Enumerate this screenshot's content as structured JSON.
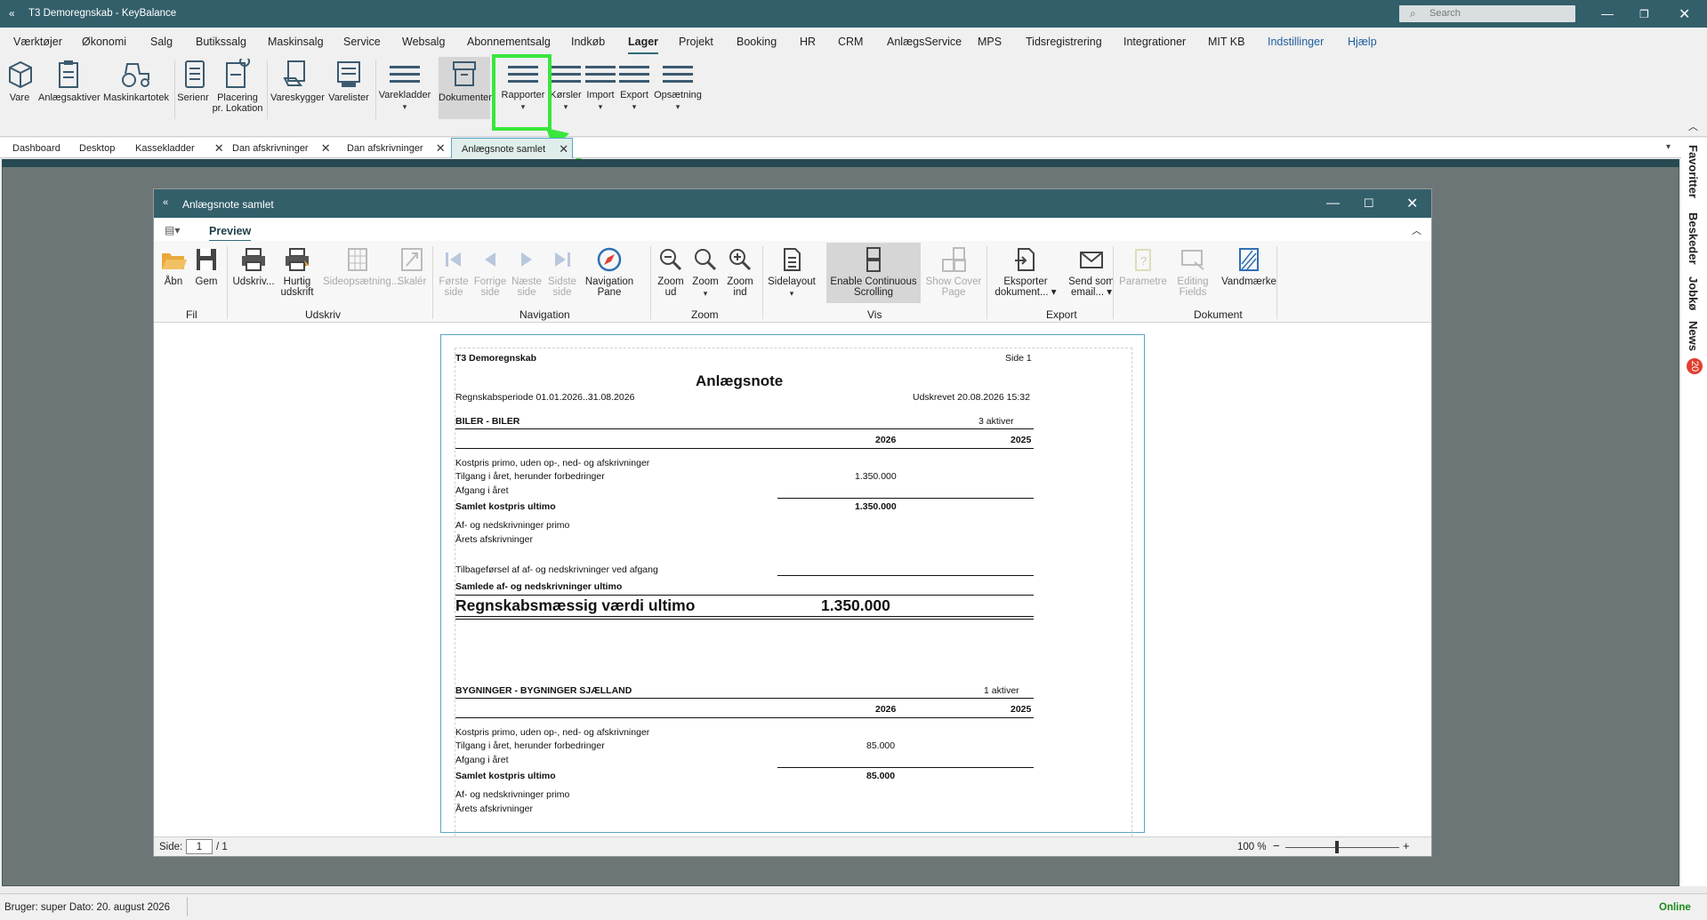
{
  "app": {
    "title": "T3 Demoregnskab - KeyBalance",
    "search_placeholder": "Search"
  },
  "menu": [
    "Værktøjer",
    "Økonomi",
    "Salg",
    "Butikssalg",
    "Maskinsalg",
    "Service",
    "Websalg",
    "Abonnementsalg",
    "Indkøb",
    "Lager",
    "Projekt",
    "Booking",
    "HR",
    "CRM",
    "AnlægsService",
    "MPS",
    "Tidsregistrering",
    "Integrationer",
    "MIT KB",
    "Indstillinger",
    "Hjælp"
  ],
  "menu_active": "Lager",
  "ribbon": {
    "vare": "Vare",
    "anlaegsaktiver": "Anlægsaktiver",
    "maskinkartotek": "Maskinkartotek",
    "serienr": "Serienr",
    "placering_1": "Placering",
    "placering_2": "pr. Lokation",
    "vareskygger": "Vareskygger",
    "varelister": "Varelister",
    "varekladder": "Varekladder",
    "dokumenter": "Dokumenter",
    "rapporter": "Rapporter",
    "koersler": "Kørsler",
    "import": "Import",
    "export": "Export",
    "opsaetning": "Opsætning"
  },
  "tabs": {
    "dashboard": "Dashboard",
    "desktop": "Desktop",
    "kassekladder": "Kassekladder",
    "dan_afskrivninger_1": "Dan afskrivninger",
    "dan_afskrivninger_2": "Dan afskrivninger",
    "anlaegsnote_samlet": "Anlægsnote samlet"
  },
  "right_panel": {
    "favoritter": "Favoritter",
    "beskeder": "Beskeder",
    "jobkø": "Jobkø",
    "news": "News",
    "news_count": "20"
  },
  "window": {
    "title": "Anlægsnote samlet",
    "tab": "Preview"
  },
  "toolbar": {
    "aabn": "Åbn",
    "gem": "Gem",
    "udskriv": "Udskriv...",
    "hurtig_1": "Hurtig",
    "hurtig_2": "udskrift",
    "sideops": "Sideopsætning...",
    "skaler": "Skalér",
    "foerste_1": "Første",
    "foerste_2": "side",
    "forrige_1": "Forrige",
    "forrige_2": "side",
    "naeste_1": "Næste",
    "naeste_2": "side",
    "sidste_1": "Sidste",
    "sidste_2": "side",
    "navpane_1": "Navigation",
    "navpane_2": "Pane",
    "zoomud_1": "Zoom",
    "zoomud_2": "ud",
    "zoom": "Zoom",
    "zoomind_1": "Zoom",
    "zoomind_2": "ind",
    "sidelayout": "Sidelayout",
    "cont_1": "Enable Continuous",
    "cont_2": "Scrolling",
    "cover_1": "Show Cover",
    "cover_2": "Page",
    "eksporter_1": "Eksporter",
    "eksporter_2": "dokument...",
    "send_1": "Send som",
    "send_2": "email...",
    "parametre": "Parametre",
    "editing_1": "Editing",
    "editing_2": "Fields",
    "vandmaerke": "Vandmærke",
    "grp_fil": "Fil",
    "grp_udskriv": "Udskriv",
    "grp_navigation": "Navigation",
    "grp_zoom": "Zoom",
    "grp_vis": "Vis",
    "grp_export": "Export",
    "grp_dokument": "Dokument"
  },
  "report": {
    "company": "T3 Demoregnskab",
    "page": "Side 1",
    "title": "Anlægsnote",
    "period": "Regnskabsperiode 01.01.2026..31.08.2026",
    "printed": "Udskrevet 20.08.2026 15:32",
    "sections": [
      {
        "header": "BILER - BILER",
        "assets": "3 aktiver",
        "col1": "2026",
        "col2": "2025",
        "kostpris_primo": "Kostpris primo, uden op-, ned- og afskrivninger",
        "tilgang": "Tilgang i året, herunder forbedringer",
        "tilgang_val": "1.350.000",
        "afgang": "Afgang i året",
        "samlet_kostpris": "Samlet kostpris ultimo",
        "samlet_kostpris_val": "1.350.000",
        "af_primo": "Af- og nedskrivninger primo",
        "aarets": "Årets afskrivninger",
        "tilbagefoersel": "Tilbageførsel af af- og nedskrivninger ved afgang",
        "samlede_af": "Samlede af- og nedskrivninger ultimo",
        "vaerdi": "Regnskabsmæssig værdi ultimo",
        "vaerdi_val": "1.350.000"
      },
      {
        "header": "BYGNINGER - BYGNINGER SJÆLLAND",
        "assets": "1 aktiver",
        "col1": "2026",
        "col2": "2025",
        "kostpris_primo": "Kostpris primo, uden op-, ned- og afskrivninger",
        "tilgang": "Tilgang i året, herunder forbedringer",
        "tilgang_val": "85.000",
        "afgang": "Afgang i året",
        "samlet_kostpris": "Samlet kostpris ultimo",
        "samlet_kostpris_val": "85.000",
        "af_primo": "Af- og nedskrivninger primo",
        "aarets": "Årets afskrivninger"
      }
    ]
  },
  "preview_status": {
    "side_label": "Side:",
    "page_value": "1",
    "page_total": "/ 1",
    "zoom": "100 %"
  },
  "status": {
    "user": "Bruger:  super  Dato:  20. august 2026",
    "online": "Online"
  },
  "colors": {
    "titlebar": "#335f6b",
    "highlight": "#39e63d",
    "online": "#1a8a1a"
  }
}
